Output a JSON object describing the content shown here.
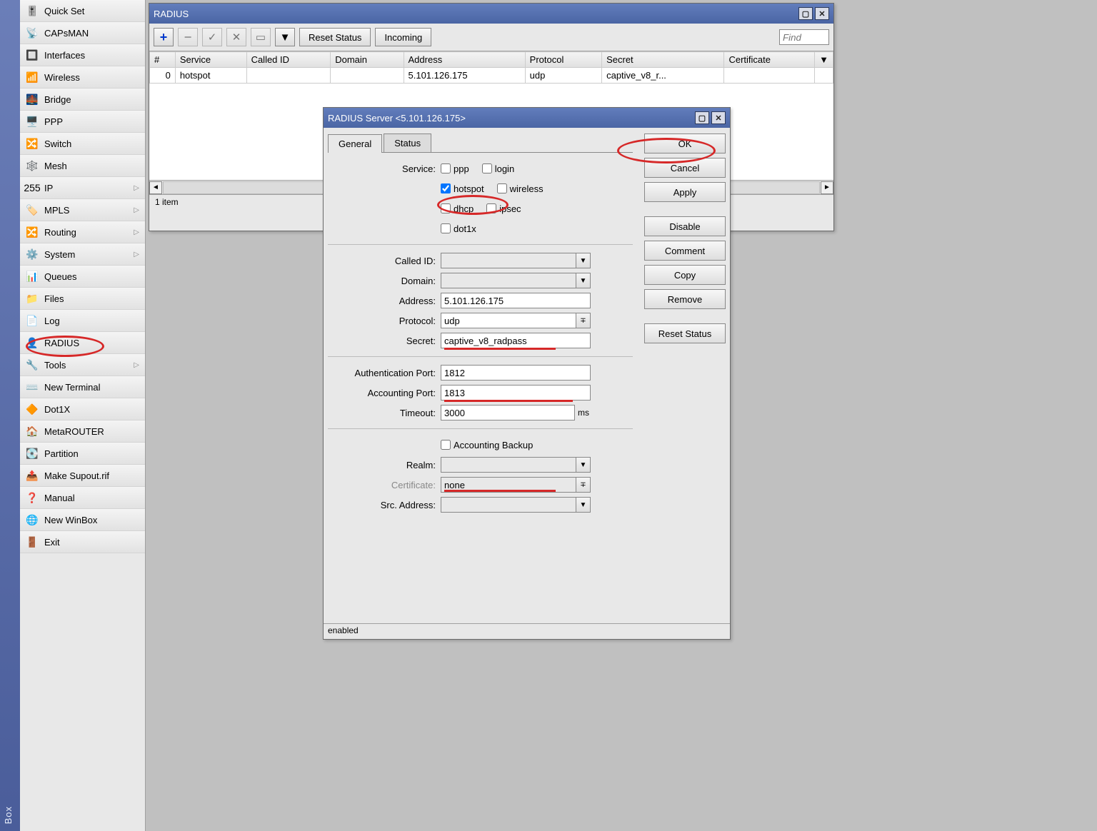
{
  "leftAccent": "Box",
  "sidebar": {
    "items": [
      {
        "label": "Quick Set",
        "icon": "🎚️",
        "arrow": false
      },
      {
        "label": "CAPsMAN",
        "icon": "📡",
        "arrow": false
      },
      {
        "label": "Interfaces",
        "icon": "🔲",
        "arrow": false
      },
      {
        "label": "Wireless",
        "icon": "📶",
        "arrow": false
      },
      {
        "label": "Bridge",
        "icon": "🌉",
        "arrow": false
      },
      {
        "label": "PPP",
        "icon": "🖥️",
        "arrow": false
      },
      {
        "label": "Switch",
        "icon": "🔀",
        "arrow": false
      },
      {
        "label": "Mesh",
        "icon": "🕸️",
        "arrow": false
      },
      {
        "label": "IP",
        "icon": "255",
        "arrow": true
      },
      {
        "label": "MPLS",
        "icon": "🏷️",
        "arrow": true
      },
      {
        "label": "Routing",
        "icon": "🔀",
        "arrow": true
      },
      {
        "label": "System",
        "icon": "⚙️",
        "arrow": true
      },
      {
        "label": "Queues",
        "icon": "📊",
        "arrow": false
      },
      {
        "label": "Files",
        "icon": "📁",
        "arrow": false
      },
      {
        "label": "Log",
        "icon": "📄",
        "arrow": false
      },
      {
        "label": "RADIUS",
        "icon": "👤",
        "arrow": false
      },
      {
        "label": "Tools",
        "icon": "🔧",
        "arrow": true
      },
      {
        "label": "New Terminal",
        "icon": "⌨️",
        "arrow": false
      },
      {
        "label": "Dot1X",
        "icon": "🔶",
        "arrow": false
      },
      {
        "label": "MetaROUTER",
        "icon": "🏠",
        "arrow": false
      },
      {
        "label": "Partition",
        "icon": "💽",
        "arrow": false
      },
      {
        "label": "Make Supout.rif",
        "icon": "📤",
        "arrow": false
      },
      {
        "label": "Manual",
        "icon": "❓",
        "arrow": false
      },
      {
        "label": "New WinBox",
        "icon": "🌐",
        "arrow": false
      },
      {
        "label": "Exit",
        "icon": "🚪",
        "arrow": false
      }
    ]
  },
  "radiusWin": {
    "title": "RADIUS",
    "toolbar": {
      "resetStatus": "Reset Status",
      "incoming": "Incoming"
    },
    "findPlaceholder": "Find",
    "cols": [
      "#",
      "Service",
      "Called ID",
      "Domain",
      "Address",
      "Protocol",
      "Secret",
      "Certificate"
    ],
    "rows": [
      {
        "n": "0",
        "service": "hotspot",
        "called": "",
        "domain": "",
        "address": "5.101.126.175",
        "protocol": "udp",
        "secret": "captive_v8_r...",
        "cert": ""
      }
    ],
    "status": "1 item"
  },
  "dlg": {
    "title": "RADIUS Server <5.101.126.175>",
    "tabs": {
      "general": "General",
      "status": "Status"
    },
    "service": {
      "label": "Service:",
      "ppp": "ppp",
      "login": "login",
      "hotspot": "hotspot",
      "wireless": "wireless",
      "dhcp": "dhcp",
      "ipsec": "ipsec",
      "dot1x": "dot1x"
    },
    "fields": {
      "calledId": {
        "label": "Called ID:",
        "value": ""
      },
      "domain": {
        "label": "Domain:",
        "value": ""
      },
      "address": {
        "label": "Address:",
        "value": "5.101.126.175"
      },
      "protocol": {
        "label": "Protocol:",
        "value": "udp"
      },
      "secret": {
        "label": "Secret:",
        "value": "captive_v8_radpass"
      },
      "authPort": {
        "label": "Authentication Port:",
        "value": "1812"
      },
      "acctPort": {
        "label": "Accounting Port:",
        "value": "1813"
      },
      "timeout": {
        "label": "Timeout:",
        "value": "3000",
        "unit": "ms"
      },
      "acctBackup": {
        "label": "Accounting Backup"
      },
      "realm": {
        "label": "Realm:",
        "value": ""
      },
      "cert": {
        "label": "Certificate:",
        "value": "none"
      },
      "srcAddr": {
        "label": "Src. Address:",
        "value": ""
      }
    },
    "buttons": {
      "ok": "OK",
      "cancel": "Cancel",
      "apply": "Apply",
      "disable": "Disable",
      "comment": "Comment",
      "copy": "Copy",
      "remove": "Remove",
      "resetStatus": "Reset Status"
    },
    "status": "enabled"
  }
}
